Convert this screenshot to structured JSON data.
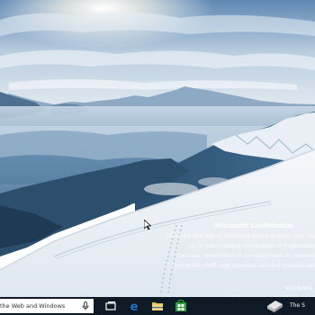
{
  "watermark": {
    "title": "Microsoft Confidential",
    "lines": [
      "Unauthorized use or disclosure in any manner may res",
      "up to and including termination of employmen",
      "services, termination of an assignment or contract",
      "contracted staff), and potential civil and criminal liab"
    ],
    "edition": "Windows",
    "build": "Evaluation copy. Build 9901.winmain_prs.141202-1718"
  },
  "taskbar": {
    "search_placeholder": "the Web and Windows",
    "tray_text": "The S"
  },
  "colors": {
    "taskbar": "#0e1a26",
    "search_bg": "#ffffff",
    "accent_edge": "#1e73c8",
    "accent_store": "#2e9e3a"
  },
  "icons": [
    "mic-icon",
    "task-view-icon",
    "edge-icon",
    "file-explorer-icon",
    "store-icon",
    "notification-icon",
    "mouse-cursor-icon"
  ]
}
